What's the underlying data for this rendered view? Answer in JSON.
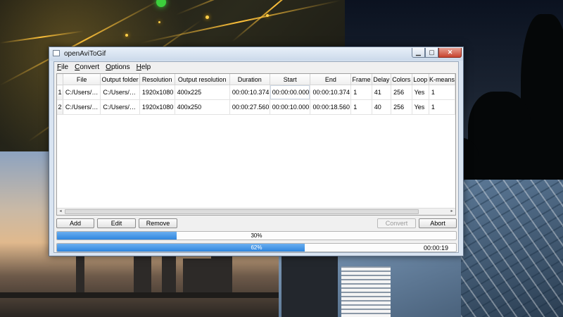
{
  "window": {
    "title": "openAviToGif",
    "controls": {
      "minimize": "▁",
      "maximize": "▢",
      "close": "✕"
    }
  },
  "menu": [
    {
      "label": "File",
      "mnemonic": "F",
      "rest": "ile"
    },
    {
      "label": "Convert",
      "mnemonic": "C",
      "rest": "onvert"
    },
    {
      "label": "Options",
      "mnemonic": "O",
      "rest": "ptions"
    },
    {
      "label": "Help",
      "mnemonic": "H",
      "rest": "elp"
    }
  ],
  "table": {
    "columns": [
      "File",
      "Output folder",
      "Resolution",
      "Output resolution",
      "Duration",
      "Start",
      "End",
      "Frame",
      "Delay",
      "Colors",
      "Loop",
      "K-means"
    ],
    "rows": [
      {
        "num": "1",
        "cells": [
          "C:/Users/…",
          "C:/Users/…",
          "1920x1080",
          "400x225",
          "00:00:10.374",
          "00:00:00.000",
          "00:00:10.374",
          "1",
          "41",
          "256",
          "Yes",
          "1"
        ]
      },
      {
        "num": "2",
        "cells": [
          "C:/Users/…",
          "C:/Users/…",
          "1920x1080",
          "400x250",
          "00:00:27.560",
          "00:00:10.000",
          "00:00:18.560",
          "1",
          "40",
          "256",
          "Yes",
          "1"
        ]
      }
    ]
  },
  "scrollbar": {
    "left_arrow": "◂",
    "right_arrow": "▸"
  },
  "buttons": {
    "add": "Add",
    "edit": "Edit",
    "remove": "Remove",
    "convert": "Convert",
    "abort": "Abort"
  },
  "progress": [
    {
      "text": "30%",
      "value": 0.3
    },
    {
      "text": "62%",
      "value": 0.62
    }
  ],
  "elapsed": "00:00:19",
  "colors": {
    "progress_fill": "#2f86df",
    "window_frame": "#d9e4f1",
    "close_button": "#c7432f"
  }
}
